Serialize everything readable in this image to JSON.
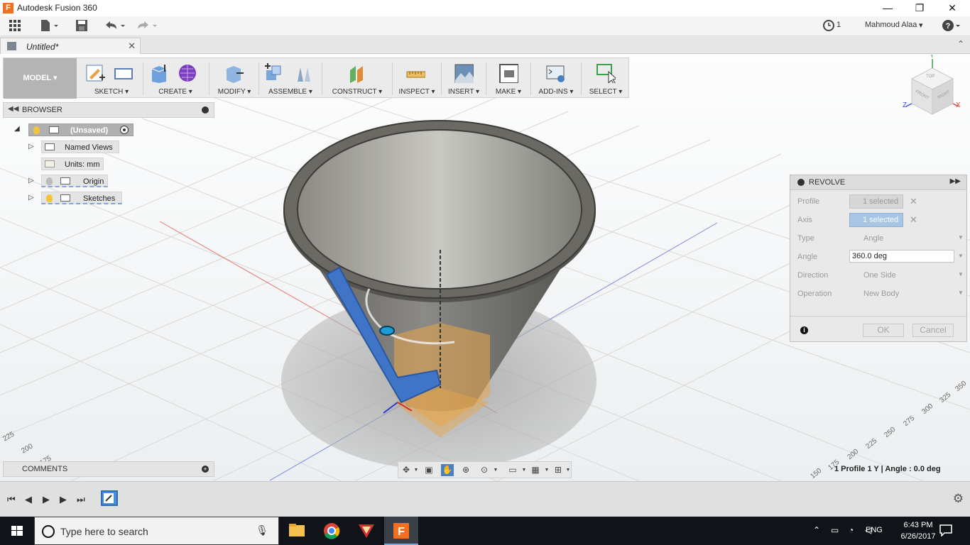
{
  "window": {
    "app_title": "Autodesk Fusion 360",
    "app_logo_letter": "F",
    "minimize": "—",
    "restore": "❐",
    "close": "✕"
  },
  "qat": {
    "job_count": "1",
    "user_name": "Mahmoud Alaa",
    "help": "?"
  },
  "tabs": {
    "document_name": "Untitled*",
    "close": "✕",
    "collapse": "⌃"
  },
  "ribbon": {
    "workspace": "MODEL ▾",
    "groups": [
      {
        "label": "SKETCH ▾"
      },
      {
        "label": "CREATE ▾"
      },
      {
        "label": "MODIFY ▾"
      },
      {
        "label": "ASSEMBLE ▾"
      },
      {
        "label": "CONSTRUCT ▾"
      },
      {
        "label": "INSPECT ▾"
      },
      {
        "label": "INSERT ▾"
      },
      {
        "label": "MAKE ▾"
      },
      {
        "label": "ADD-INS ▾"
      },
      {
        "label": "SELECT ▾"
      }
    ]
  },
  "browser": {
    "title": "BROWSER",
    "root": "(Unsaved)",
    "items": [
      {
        "label": "Named Views"
      },
      {
        "label": "Units: mm"
      },
      {
        "label": "Origin"
      },
      {
        "label": "Sketches"
      }
    ]
  },
  "comments": {
    "title": "COMMENTS",
    "add": "+"
  },
  "viewcube": {
    "top": "TOP",
    "front": "FRONT",
    "right": "RIGHT",
    "axis_x": "X",
    "axis_y": "Y",
    "axis_z": "Z"
  },
  "grid_labels": {
    "left": [
      "225",
      "200",
      "175"
    ],
    "right": [
      "350",
      "325",
      "300",
      "275",
      "250",
      "225",
      "200",
      "175",
      "150"
    ]
  },
  "revolve": {
    "title": "REVOLVE",
    "profile_label": "Profile",
    "profile_value": "1 selected",
    "axis_label": "Axis",
    "axis_value": "1 selected",
    "type_label": "Type",
    "type_value": "Angle",
    "angle_label": "Angle",
    "angle_value": "360.0 deg",
    "direction_label": "Direction",
    "direction_value": "One Side",
    "operation_label": "Operation",
    "operation_value": "New Body",
    "ok": "OK",
    "cancel": "Cancel",
    "info": "i"
  },
  "status": {
    "text": "1 Profile 1 Y | Angle : 0.0 deg"
  },
  "taskbar": {
    "search_placeholder": "Type here to search",
    "language": "ENG",
    "time": "6:43 PM",
    "date": "6/26/2017"
  }
}
